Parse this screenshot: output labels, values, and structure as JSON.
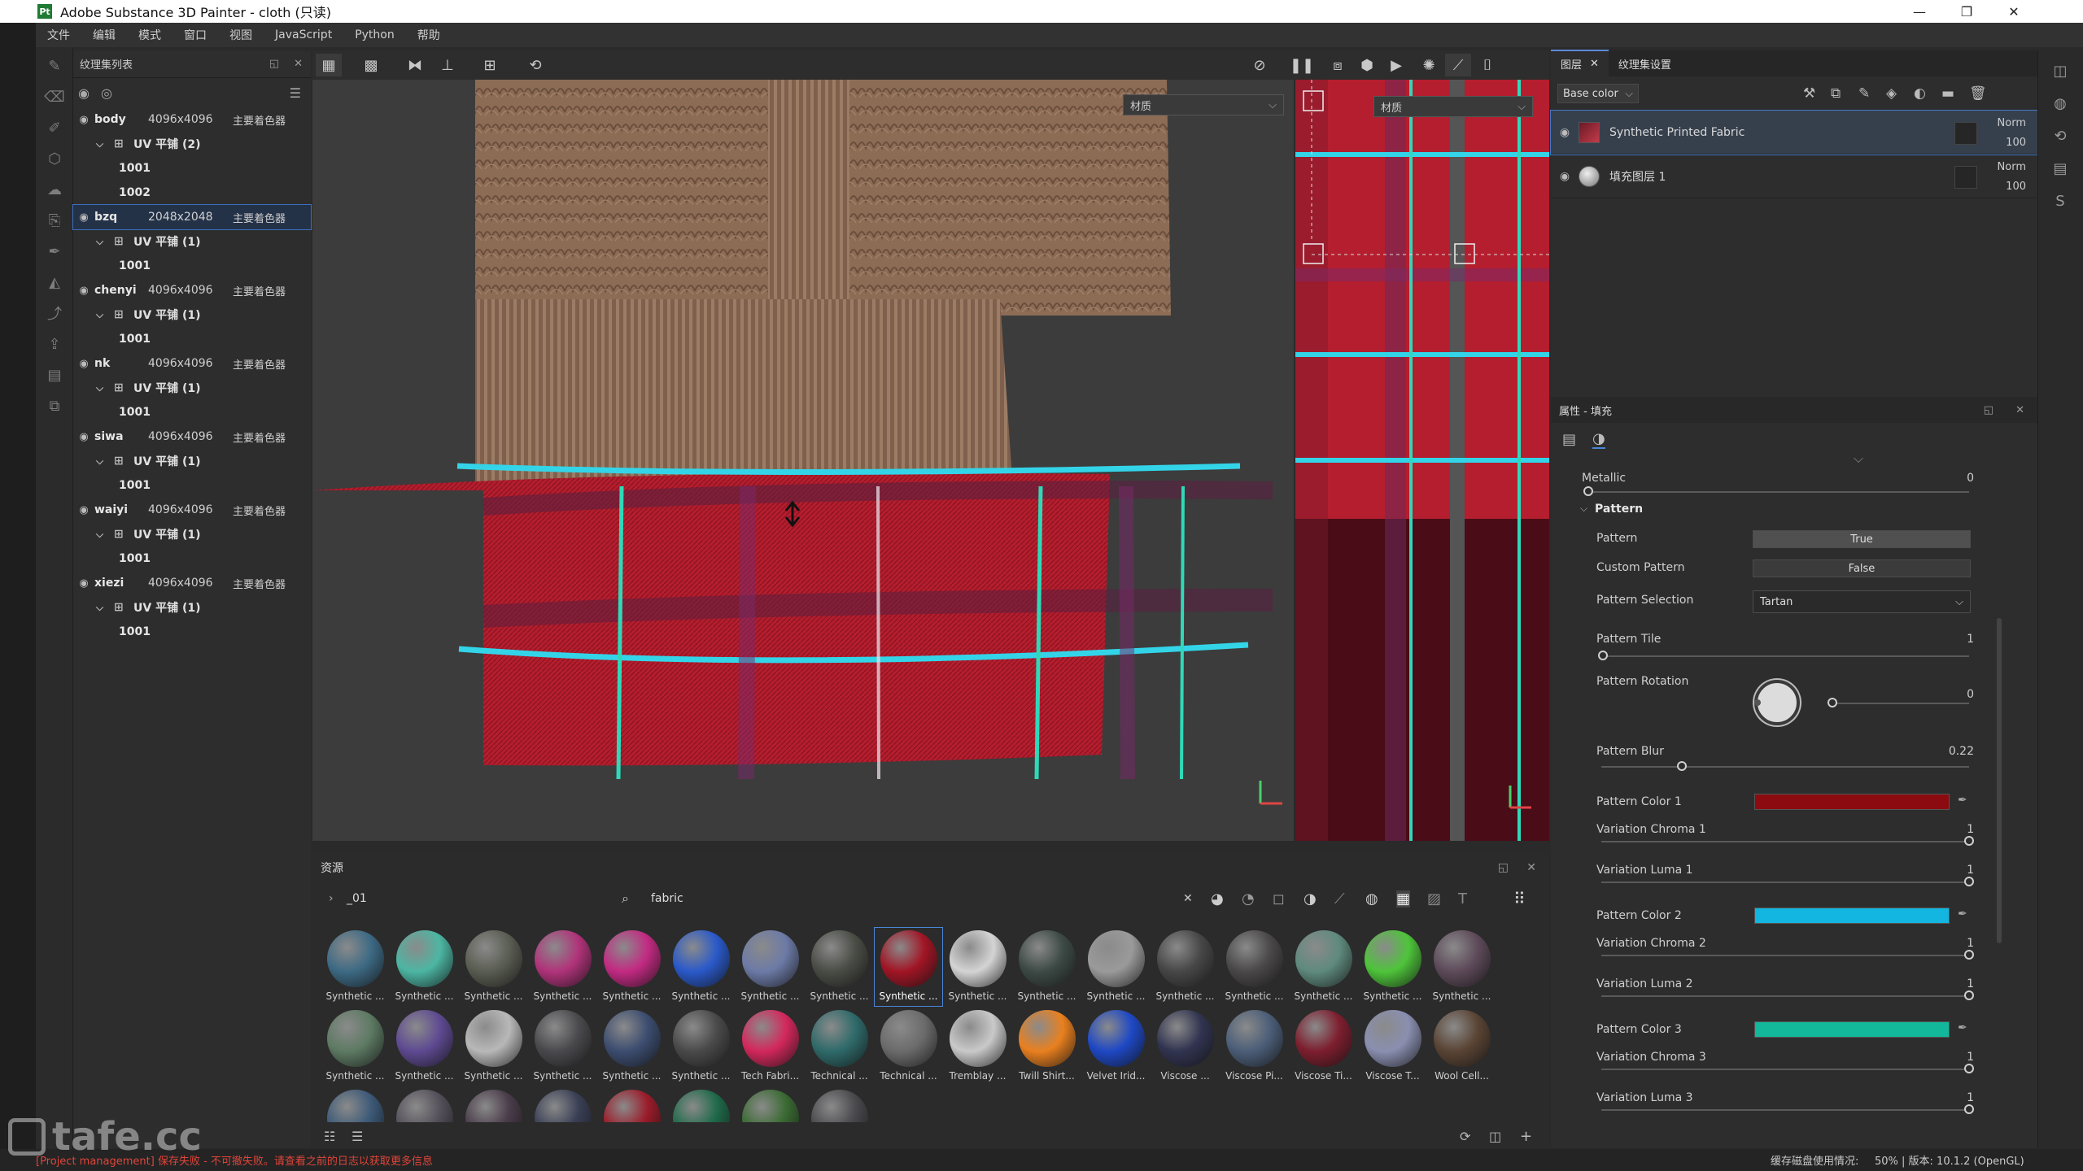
{
  "app": {
    "title": "Adobe Substance 3D Painter - cloth (只读)",
    "logo": "Pt",
    "window_controls": [
      "—",
      "❐",
      "✕"
    ]
  },
  "menu": [
    "文件",
    "编辑",
    "模式",
    "窗口",
    "视图",
    "JavaScript",
    "Python",
    "帮助"
  ],
  "texture_set_list": {
    "title": "纹理集列表",
    "items": [
      {
        "name": "body",
        "res": "4096x4096",
        "shader": "主要着色器",
        "uv": "UV 平铺 (2)",
        "tiles": [
          "1001",
          "1002"
        ],
        "selected": false
      },
      {
        "name": "bzq",
        "res": "2048x2048",
        "shader": "主要着色器",
        "uv": "UV 平铺 (1)",
        "tiles": [
          "1001"
        ],
        "selected": true
      },
      {
        "name": "chenyi",
        "res": "4096x4096",
        "shader": "主要着色器",
        "uv": "UV 平铺 (1)",
        "tiles": [
          "1001"
        ],
        "selected": false
      },
      {
        "name": "nk",
        "res": "4096x4096",
        "shader": "主要着色器",
        "uv": "UV 平铺 (1)",
        "tiles": [
          "1001"
        ],
        "selected": false
      },
      {
        "name": "siwa",
        "res": "4096x4096",
        "shader": "主要着色器",
        "uv": "UV 平铺 (1)",
        "tiles": [
          "1001"
        ],
        "selected": false
      },
      {
        "name": "waiyi",
        "res": "4096x4096",
        "shader": "主要着色器",
        "uv": "UV 平铺 (1)",
        "tiles": [
          "1001"
        ],
        "selected": false
      },
      {
        "name": "xiezi",
        "res": "4096x4096",
        "shader": "主要着色器",
        "uv": "UV 平铺 (1)",
        "tiles": [
          "1001"
        ],
        "selected": false
      }
    ]
  },
  "viewport": {
    "material_label_3d": "材质",
    "material_label_2d": "材质"
  },
  "layers_panel": {
    "tab_layers": "图层",
    "tab_settings": "纹理集设置",
    "channel": "Base color",
    "layers": [
      {
        "name": "Synthetic Printed Fabric",
        "blend": "Norm",
        "opacity": "100",
        "active": true
      },
      {
        "name": "填充图层 1",
        "blend": "Norm",
        "opacity": "100",
        "active": false
      }
    ]
  },
  "properties": {
    "title": "属性 - 填充",
    "metallic_label": "Metallic",
    "metallic_value": "0",
    "section": "Pattern",
    "pattern_label": "Pattern",
    "pattern_value": "True",
    "custom_pattern_label": "Custom Pattern",
    "custom_pattern_value": "False",
    "pattern_selection_label": "Pattern Selection",
    "pattern_selection_value": "Tartan",
    "pattern_tile_label": "Pattern Tile",
    "pattern_tile_value": "1",
    "pattern_rotation_label": "Pattern Rotation",
    "pattern_rotation_value": "0",
    "pattern_blur_label": "Pattern Blur",
    "pattern_blur_value": "0.22",
    "pattern_color_1_label": "Pattern Color 1",
    "pattern_color_1": "#8b0b10",
    "variation_chroma_1_label": "Variation Chroma 1",
    "variation_chroma_1_value": "1",
    "variation_luma_1_label": "Variation Luma 1",
    "variation_luma_1_value": "1",
    "pattern_color_2_label": "Pattern Color 2",
    "pattern_color_2": "#12b6e0",
    "variation_chroma_2_label": "Variation Chroma 2",
    "variation_chroma_2_value": "1",
    "variation_luma_2_label": "Variation Luma 2",
    "variation_luma_2_value": "1",
    "pattern_color_3_label": "Pattern Color 3",
    "pattern_color_3": "#13b89a",
    "variation_chroma_3_label": "Variation Chroma 3",
    "variation_chroma_3_value": "1",
    "variation_luma_3_label": "Variation Luma 3",
    "variation_luma_3_value": "1"
  },
  "assets": {
    "title": "资源",
    "path": "_01",
    "search": "fabric",
    "row1": [
      {
        "label": "Synthetic ...",
        "color": "#3d6a84"
      },
      {
        "label": "Synthetic ...",
        "color": "#4cb6a3"
      },
      {
        "label": "Synthetic ...",
        "color": "#5a5d52"
      },
      {
        "label": "Synthetic ...",
        "color": "#b0337a"
      },
      {
        "label": "Synthetic ...",
        "color": "#c22a82"
      },
      {
        "label": "Synthetic ...",
        "color": "#2a59c9"
      },
      {
        "label": "Synthetic ...",
        "color": "#6c7aa6"
      },
      {
        "label": "Synthetic ...",
        "color": "#4a4c45"
      },
      {
        "label": "Synthetic ...",
        "color": "#a11525"
      },
      {
        "label": "Synthetic ...",
        "color": "#d4d4d4"
      },
      {
        "label": "Synthetic ...",
        "color": "#3d4a46"
      },
      {
        "label": "Synthetic ...",
        "color": "#9a9a9a"
      },
      {
        "label": "Synthetic ...",
        "color": "#474747"
      },
      {
        "label": "Synthetic ...",
        "color": "#4a4848"
      },
      {
        "label": "Synthetic ...",
        "color": "#5f8a7d"
      },
      {
        "label": "Synthetic ...",
        "color": "#4ec43a"
      },
      {
        "label": "Synthetic ...",
        "color": "#5e4a5a"
      }
    ],
    "row2": [
      {
        "label": "Synthetic ...",
        "color": "#5d7a63"
      },
      {
        "label": "Synthetic ...",
        "color": "#5e4a92"
      },
      {
        "label": "Synthetic ...",
        "color": "#b8b8b8"
      },
      {
        "label": "Synthetic ...",
        "color": "#4a4a4e"
      },
      {
        "label": "Synthetic ...",
        "color": "#3c4d70"
      },
      {
        "label": "Synthetic ...",
        "color": "#4a4a4a"
      },
      {
        "label": "Tech Fabri...",
        "color": "#d3285c"
      },
      {
        "label": "Technical ...",
        "color": "#2f6a6a"
      },
      {
        "label": "Technical ...",
        "color": "#6b6b6b"
      },
      {
        "label": "Tremblay ...",
        "color": "#c9c9c9"
      },
      {
        "label": "Twill Shirt...",
        "color": "#e9801f"
      },
      {
        "label": "Velvet Irid...",
        "color": "#1e48c4"
      },
      {
        "label": "Viscose ...",
        "color": "#313450"
      },
      {
        "label": "Viscose Pi...",
        "color": "#4b5e78"
      },
      {
        "label": "Viscose Ti...",
        "color": "#7d1e2e"
      },
      {
        "label": "Viscose T...",
        "color": "#8a8fb0"
      },
      {
        "label": "Wool Cell...",
        "color": "#5a4434"
      }
    ],
    "row3": [
      {
        "color": "#3d5a78"
      },
      {
        "color": "#54505a"
      },
      {
        "color": "#4a3c4a"
      },
      {
        "color": "#3a3f55"
      },
      {
        "color": "#9a1c2a"
      },
      {
        "color": "#1f6a4a"
      },
      {
        "color": "#3a6a32"
      },
      {
        "color": "#4a4a4e"
      }
    ]
  },
  "status": {
    "error": "[Project management] 保存失败 - 不可撤失败。请查看之前的日志以获取更多信息",
    "cache": "缓存磁盘使用情况:",
    "version": "50% | 版本: 10.1.2 (OpenGL)"
  },
  "watermark": "tafe.cc",
  "colors": {
    "accent": "#4a86d8",
    "plaid_red": "#b51e2e",
    "plaid_cyan": "#33d4e8",
    "knit_brown": "#8a6a54"
  }
}
